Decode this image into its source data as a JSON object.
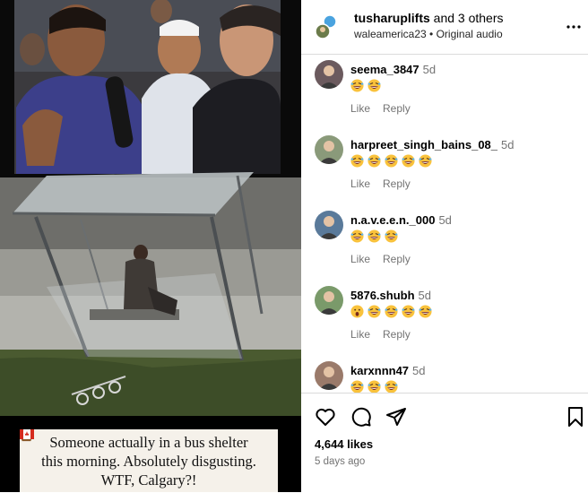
{
  "post": {
    "header": {
      "username": "tusharuplifts",
      "others": "and 3 others",
      "subtitle": "walеamerica23 • Original audio"
    },
    "caption": {
      "line1_before": "Someone actually",
      "line1_after": "in a bus shelter",
      "line2": "this morning. Absolutely disgusting.",
      "line3": "WTF, Calgary?!"
    },
    "comments": [
      {
        "user": "seema_3847",
        "time": "5d",
        "emojis": [
          "laugh",
          "laugh"
        ],
        "like": "Like",
        "reply": "Reply"
      },
      {
        "user": "harpreet_singh_bains_08_",
        "time": "5d",
        "emojis": [
          "laugh",
          "laugh",
          "laugh",
          "laugh",
          "laugh"
        ],
        "like": "Like",
        "reply": "Reply"
      },
      {
        "user": "n.a.v.e.e.n._000",
        "time": "5d",
        "emojis": [
          "laugh",
          "laugh",
          "laugh"
        ],
        "like": "Like",
        "reply": "Reply"
      },
      {
        "user": "5876.shubh",
        "time": "5d",
        "emojis": [
          "shock",
          "laugh",
          "laugh",
          "laugh",
          "laugh"
        ],
        "like": "Like",
        "reply": "Reply"
      },
      {
        "user": "karxnnn47",
        "time": "5d",
        "emojis": [
          "laugh",
          "laugh",
          "laugh"
        ],
        "like": "Like",
        "reply": "Reply"
      }
    ],
    "likes": "4,644 likes",
    "date": "5 days ago",
    "icons": [
      "heart-icon",
      "comment-icon",
      "share-icon",
      "bookmark-icon",
      "more-icon"
    ]
  }
}
